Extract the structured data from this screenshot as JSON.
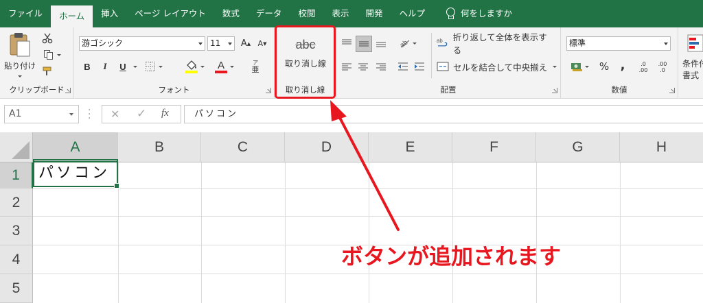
{
  "tabs": [
    {
      "label": "ファイル",
      "active": false
    },
    {
      "label": "ホーム",
      "active": true
    },
    {
      "label": "挿入",
      "active": false
    },
    {
      "label": "ページ レイアウト",
      "active": false
    },
    {
      "label": "数式",
      "active": false
    },
    {
      "label": "データ",
      "active": false
    },
    {
      "label": "校閲",
      "active": false
    },
    {
      "label": "表示",
      "active": false
    },
    {
      "label": "開発",
      "active": false
    },
    {
      "label": "ヘルプ",
      "active": false
    }
  ],
  "tell_me": "何をしますか",
  "clipboard": {
    "paste_label": "貼り付け",
    "group_label": "クリップボード"
  },
  "font": {
    "name": "游ゴシック",
    "size": "11",
    "bold": "B",
    "italic": "I",
    "underline": "U",
    "grow": "A",
    "shrink": "A",
    "furigana": "亜",
    "group_label": "フォント",
    "fill_color": "#ffff00",
    "font_color": "#e8171f"
  },
  "strike": {
    "icon_text": "abc",
    "button_label": "取り消し線",
    "group_label": "取り消し線"
  },
  "alignment": {
    "wrap_label": "折り返して全体を表示する",
    "merge_label": "セルを結合して中央揃え",
    "group_label": "配置"
  },
  "number": {
    "format": "標準",
    "percent": "%",
    "comma": ",",
    "inc_decimal_top": ".0",
    "inc_decimal_bottom": ".00",
    "dec_decimal_top": ".00",
    "dec_decimal_bottom": ".0",
    "group_label": "数値"
  },
  "styles": {
    "cond_label_1": "条件付",
    "cond_label_2": "書式"
  },
  "formula_bar": {
    "name_box": "A1",
    "cancel": "✕",
    "enter": "✓",
    "fx": "fx",
    "content": "パソコン"
  },
  "columns": [
    "A",
    "B",
    "C",
    "D",
    "E",
    "F",
    "G",
    "H"
  ],
  "rows": [
    "1",
    "2",
    "3",
    "4",
    "5"
  ],
  "cells": {
    "A1": "パソコン"
  },
  "annotation": {
    "text": "ボタンが追加されます",
    "color": "#e8171f"
  },
  "colors": {
    "excel_green": "#217346",
    "highlight_red": "#e8171f"
  }
}
